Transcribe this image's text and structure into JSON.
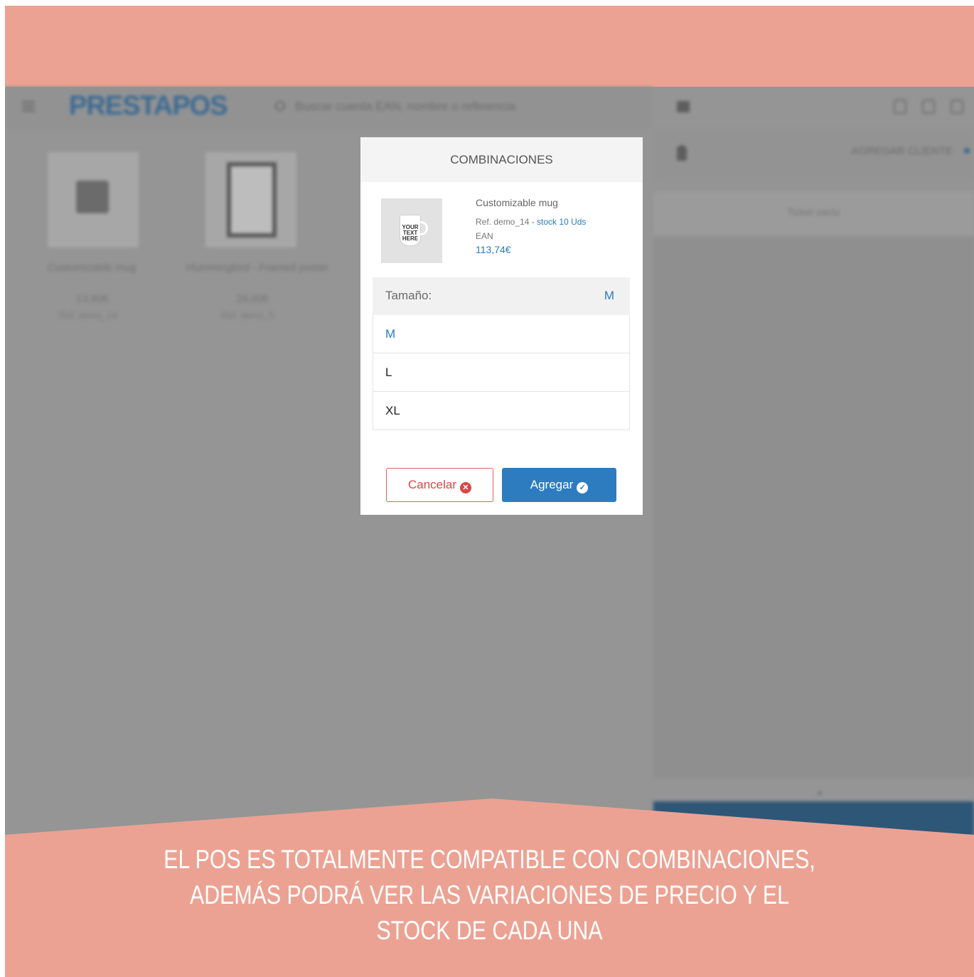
{
  "app": {
    "logo": "PRESTAPOS",
    "search_placeholder": "Buscar cuenta EAN, nombre o referencia",
    "client_label": "AGREGAR CLIENTE",
    "ticket_label": "Ticket vacío",
    "products": [
      {
        "name": "Customizable mug",
        "price": "13,90€",
        "sub": "Ref. demo_14"
      },
      {
        "name": "Hummingbird - Framed poster",
        "price": "29,00€",
        "sub": "Ref. demo_5"
      }
    ]
  },
  "modal": {
    "title": "COMBINACIONES",
    "product": {
      "thumb_text": "YOUR TEXT HERE",
      "name": "Customizable mug",
      "ref": "Ref. demo_14 - ",
      "stock": "stock 10 Uds",
      "ean": "EAN",
      "price": "113,74€"
    },
    "group": {
      "label": "Tamaño:",
      "value": "M"
    },
    "options": [
      "M",
      "L",
      "XL"
    ],
    "selected_option": "M",
    "cancel_label": "Cancelar",
    "add_label": "Agregar"
  },
  "banner": {
    "line1": "EL POS ES TOTALMENTE COMPATIBLE CON COMBINACIONES,",
    "line2": "ADEMÁS PODRÁ VER LAS VARIACIONES DE PRECIO Y EL",
    "line3": "STOCK DE CADA UNA"
  },
  "colors": {
    "banner": "#eca293",
    "accent": "#2e7cc0",
    "danger": "#d94646",
    "overlay": "#959595"
  },
  "icons": [
    "hamburger-icon",
    "search-icon",
    "cart-icon",
    "user-icon",
    "x-circle-icon",
    "check-circle-icon"
  ]
}
